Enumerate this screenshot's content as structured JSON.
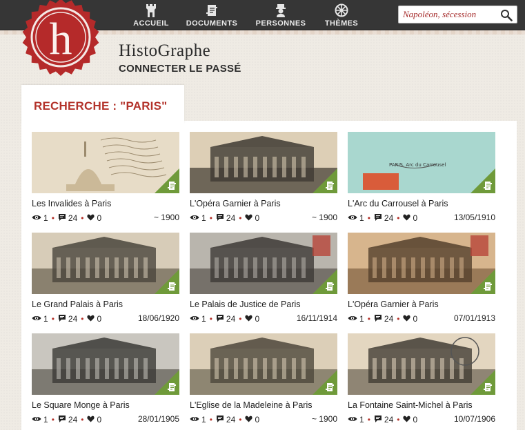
{
  "nav": {
    "items": [
      {
        "label": "ACCUEIL",
        "icon": "tower-icon"
      },
      {
        "label": "DOCUMENTS",
        "icon": "scroll-icon"
      },
      {
        "label": "PERSONNES",
        "icon": "person-icon"
      },
      {
        "label": "THÈMES",
        "icon": "wheel-icon"
      }
    ],
    "search": {
      "value": "Napoléon, sécession"
    }
  },
  "brand": {
    "logo_letter": "h",
    "title": "HistoGraphe",
    "tagline": "CONNECTER LE PASSÉ"
  },
  "results": {
    "heading": "RECHERCHE : \"PARIS\"",
    "accent_color": "#b3322a",
    "corner_color": "#6f9a3a",
    "cards": [
      {
        "title": "Les Invalides à Paris",
        "views": "1",
        "comments": "24",
        "likes": "0",
        "date": "~ 1900",
        "thumb": "sepia-handwritten"
      },
      {
        "title": "L'Opéra Garnier à Paris",
        "views": "1",
        "comments": "24",
        "likes": "0",
        "date": "~ 1900",
        "thumb": "sepia-building"
      },
      {
        "title": "L'Arc du Carrousel à Paris",
        "views": "1",
        "comments": "24",
        "likes": "0",
        "date": "13/05/1910",
        "thumb": "teal-stamp"
      },
      {
        "title": "Le Grand Palais à Paris",
        "views": "1",
        "comments": "24",
        "likes": "0",
        "date": "18/06/1920",
        "thumb": "sepia-glass"
      },
      {
        "title": "Le Palais de Justice de Paris",
        "views": "1",
        "comments": "24",
        "likes": "0",
        "date": "16/11/1914",
        "thumb": "gray-building"
      },
      {
        "title": "L'Opéra Garnier à Paris",
        "views": "1",
        "comments": "24",
        "likes": "0",
        "date": "07/01/1913",
        "thumb": "sepia-opera"
      },
      {
        "title": "Le Square Monge à Paris",
        "views": "1",
        "comments": "24",
        "likes": "0",
        "date": "28/01/1905",
        "thumb": "gray-park"
      },
      {
        "title": "L'Eglise de la Madeleine à Paris",
        "views": "1",
        "comments": "24",
        "likes": "0",
        "date": "~ 1900",
        "thumb": "sepia-temple"
      },
      {
        "title": "La Fontaine Saint-Michel à Paris",
        "views": "1",
        "comments": "24",
        "likes": "0",
        "date": "10/07/1906",
        "thumb": "sepia-fountain"
      }
    ]
  }
}
